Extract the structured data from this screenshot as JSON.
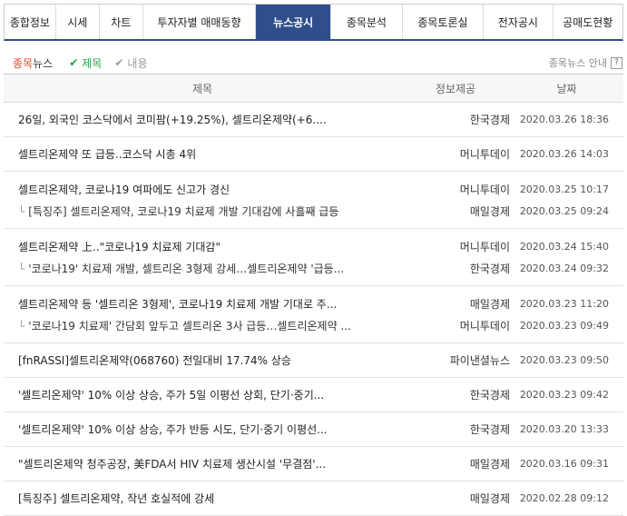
{
  "tabs": [
    {
      "label": "종합정보",
      "width": 52
    },
    {
      "label": "시세",
      "width": 44
    },
    {
      "label": "차트",
      "width": 44
    },
    {
      "label": "투자자별 매매동향",
      "width": 114
    },
    {
      "label": "뉴스공시",
      "width": 76
    },
    {
      "label": "종목분석",
      "width": 72
    },
    {
      "label": "종목토론실",
      "width": 82
    },
    {
      "label": "전자공시",
      "width": 70
    },
    {
      "label": "공매도현황",
      "width": 70
    }
  ],
  "active_tab": 4,
  "filter": {
    "title_red": "종목",
    "title_rest": "뉴스",
    "opt_title": "제목",
    "opt_content": "내용",
    "help": "종목뉴스 안내",
    "help_mark": "?"
  },
  "header": {
    "title": "제목",
    "source": "정보제공",
    "date": "날짜"
  },
  "groups": [
    {
      "rows": [
        {
          "title": "26일, 외국인 코스닥에서 코미팜(+19.25%), 셀트리온제약(+6....",
          "source": "한국경제",
          "date": "2020.03.26 18:36"
        }
      ]
    },
    {
      "rows": [
        {
          "title": "셀트리온제약 또 급등..코스닥 시총 4위",
          "source": "머니투데이",
          "date": "2020.03.26 14:03"
        }
      ]
    },
    {
      "rows": [
        {
          "title": "셀트리온제약, 코로나19 여파에도 신고가 경신",
          "source": "머니투데이",
          "date": "2020.03.25 10:17"
        },
        {
          "title": "[특징주] 셀트리온제약, 코로나19 치료제 개발 기대감에 사흘째 급등",
          "source": "매일경제",
          "date": "2020.03.25 09:24",
          "sub": true
        }
      ]
    },
    {
      "rows": [
        {
          "title": "셀트리온제약 上..\"코로나19 치료제 기대감\"",
          "source": "머니투데이",
          "date": "2020.03.24 15:40"
        },
        {
          "title": "'코로나19' 치료제 개발, 셀트리온 3형제 강세…셀트리온제약 '급등...",
          "source": "한국경제",
          "date": "2020.03.24 09:32",
          "sub": true
        }
      ]
    },
    {
      "rows": [
        {
          "title": "셀트리온제약 등 '셀트리온 3형제', 코로나19 치료제 개발 기대로 주...",
          "source": "매일경제",
          "date": "2020.03.23 11:20"
        },
        {
          "title": "'코로나19 치료제' 간담회 앞두고 셀트리온 3사 급등…셀트리온제약 ...",
          "source": "머니투데이",
          "date": "2020.03.23 09:49",
          "sub": true
        }
      ]
    },
    {
      "rows": [
        {
          "title": "[fnRASSI]셀트리온제약(068760) 전일대비 17.74% 상승",
          "source": "파이낸셜뉴스",
          "date": "2020.03.23 09:50"
        }
      ]
    },
    {
      "rows": [
        {
          "title": "'셀트리온제약' 10% 이상 상승, 주가 5일 이평선 상회, 단기·중기...",
          "source": "한국경제",
          "date": "2020.03.23 09:42"
        }
      ]
    },
    {
      "rows": [
        {
          "title": "'셀트리온제약' 10% 이상 상승, 주가 반등 시도, 단기·중기 이평선...",
          "source": "한국경제",
          "date": "2020.03.20 13:33"
        }
      ]
    },
    {
      "rows": [
        {
          "title": "\"셀트리온제약 청주공장, 美FDA서 HIV 치료제 생산시설 '무결점'...",
          "source": "매일경제",
          "date": "2020.03.16 09:31"
        }
      ]
    },
    {
      "rows": [
        {
          "title": "[특징주] 셀트리온제약, 작년 호실적에 강세",
          "source": "매일경제",
          "date": "2020.02.28 09:12"
        }
      ]
    }
  ]
}
